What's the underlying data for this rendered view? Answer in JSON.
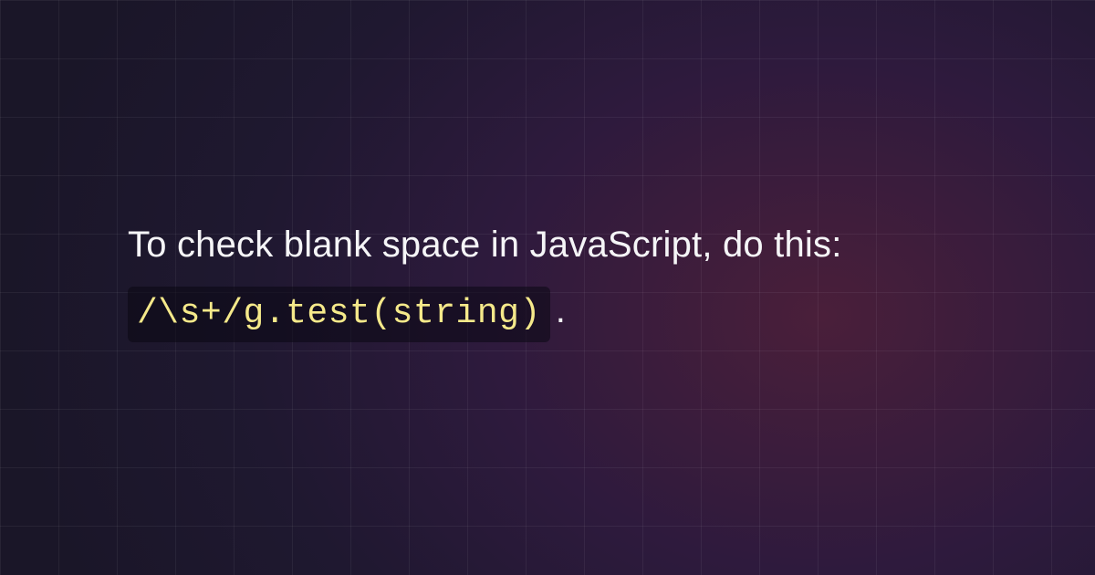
{
  "heading": "To check blank space in JavaScript, do this:",
  "code": "/\\s+/g.test(string)",
  "trailing": "."
}
